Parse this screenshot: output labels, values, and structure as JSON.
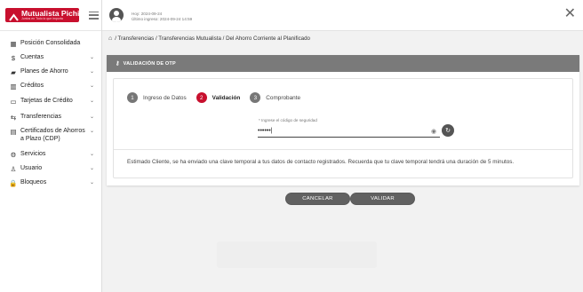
{
  "brand": {
    "name": "Mutualista Pichincha",
    "tagline": "Juntos en Todo lo que importa"
  },
  "header": {
    "login_today": "Hoy: 2024-09-24",
    "login_last": "Último ingreso: 2024-09-24 14:59"
  },
  "sidebar": {
    "items": [
      {
        "icon": "▦",
        "label": "Posición Consolidada",
        "chevron": ""
      },
      {
        "icon": "$",
        "label": "Cuentas",
        "chevron": "⌄"
      },
      {
        "icon": "▰",
        "label": "Planes de Ahorro",
        "chevron": "⌄"
      },
      {
        "icon": "▥",
        "label": "Créditos",
        "chevron": "⌄"
      },
      {
        "icon": "▭",
        "label": "Tarjetas de Crédito",
        "chevron": "⌄"
      },
      {
        "icon": "⇆",
        "label": "Transferencias",
        "chevron": "⌄"
      },
      {
        "icon": "▤",
        "label": "Certificados de Ahorros a Plazo (CDP)",
        "chevron": "⌄"
      },
      {
        "icon": "⚙",
        "label": "Servicios",
        "chevron": "⌄"
      },
      {
        "icon": "♙",
        "label": "Usuario",
        "chevron": "⌄"
      },
      {
        "icon": "🔒",
        "label": "Bloqueos",
        "chevron": "⌄"
      }
    ]
  },
  "breadcrumb": {
    "home_icon": "⌂",
    "path": "/ Transferencias / Transferencias Mutualista / Del Ahorro Corriente al Planificado"
  },
  "card": {
    "title": "VALIDACIÓN DE OTP",
    "steps": [
      {
        "num": "1",
        "label": "Ingreso de Datos"
      },
      {
        "num": "2",
        "label": "Validación"
      },
      {
        "num": "3",
        "label": "Comprobante"
      }
    ],
    "otp_label": "* Ingrese el código de seguridad",
    "otp_value": "••••••|",
    "message": "Estimado Cliente, se ha enviado una clave temporal a tus datos de contacto registrados. Recuerda que tu clave temporal tendrá una duración de 5 minutos."
  },
  "actions": {
    "cancel": "CANCELAR",
    "validate": "VALIDAR"
  },
  "colors": {
    "brand": "#c8102e",
    "header_bar": "#7a7a7a",
    "button": "#616161"
  }
}
